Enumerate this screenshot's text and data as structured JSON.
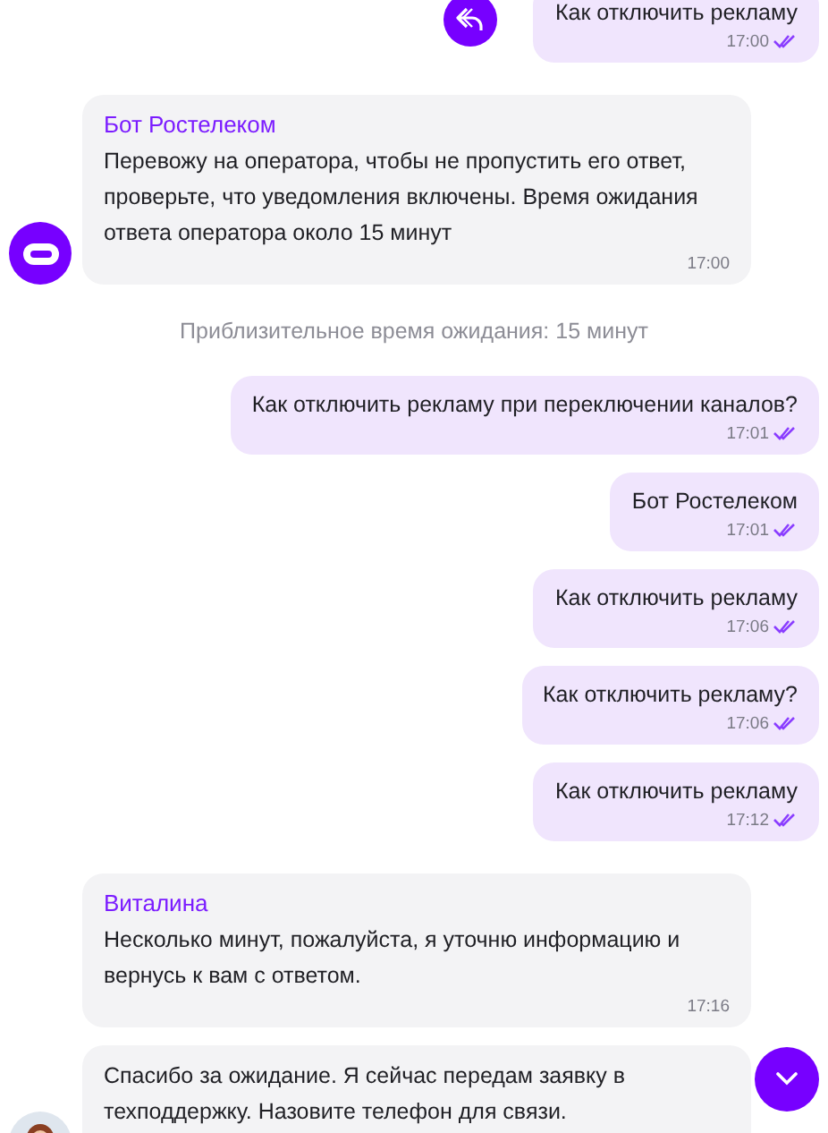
{
  "messages": [
    {
      "kind": "outgoing",
      "text": "Как отключить рекламу",
      "time": "17:00",
      "read": true,
      "reply_button": true
    },
    {
      "kind": "incoming",
      "avatar": {
        "kind": "bot"
      },
      "sender": "Бот Ростелеком",
      "text": "Перевожу на оператора, чтобы не пропустить его ответ, проверьте, что уведомления включены. Время ожидания ответа оператора около 15 минут",
      "time": "17:00"
    },
    {
      "kind": "system",
      "text": "Приблизительное время ожидания: 15 минут"
    },
    {
      "kind": "outgoing",
      "text": "Как отключить рекламу при переключении каналов?",
      "time": "17:01",
      "read": true,
      "reply_button": false
    },
    {
      "kind": "outgoing",
      "text": "Бот Ростелеком",
      "time": "17:01",
      "read": true,
      "reply_button": false
    },
    {
      "kind": "outgoing",
      "text": "Как отключить рекламу",
      "time": "17:06",
      "read": true,
      "reply_button": false
    },
    {
      "kind": "outgoing",
      "text": "Как отключить рекламу?",
      "time": "17:06",
      "read": true,
      "reply_button": false
    },
    {
      "kind": "outgoing",
      "text": "Как отключить рекламу",
      "time": "17:12",
      "read": true,
      "reply_button": false
    },
    {
      "kind": "incoming",
      "sender": "Виталина",
      "text": "Несколько минут, пожалуйста, я уточню информацию и вернусь к вам с ответом.",
      "time": "17:16"
    },
    {
      "kind": "incoming",
      "avatar": {
        "kind": "operator"
      },
      "text": "Спасибо за ожидание. Я сейчас передам заявку в техподдержку. Назовите телефон для связи."
    }
  ]
}
